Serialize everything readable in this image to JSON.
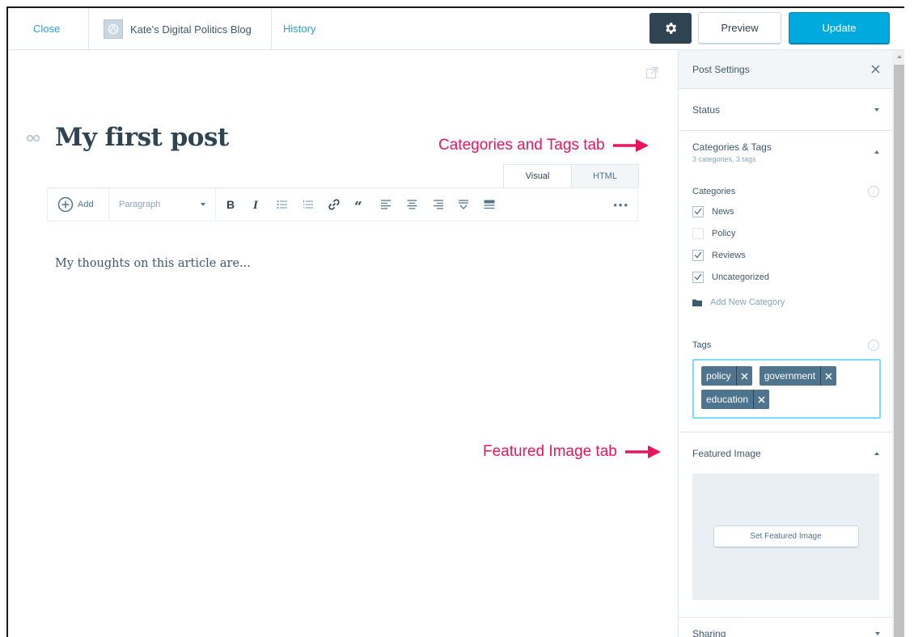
{
  "topbar": {
    "close_label": "Close",
    "site_name": "Kate's Digital Politics Blog",
    "history_label": "History",
    "preview_label": "Preview",
    "update_label": "Update"
  },
  "editor": {
    "title": "My first post",
    "body": "My thoughts on this article are...",
    "tabs": [
      "Visual",
      "HTML"
    ],
    "toolbar": {
      "add_label": "Add",
      "format_label": "Paragraph",
      "more_label": "•••"
    }
  },
  "sidebar": {
    "title": "Post Settings",
    "status_label": "Status",
    "cats_tags_label": "Categories & Tags",
    "cats_tags_summary": "3 categories, 3 tags",
    "categories_label": "Categories",
    "categories": [
      {
        "label": "News",
        "checked": true
      },
      {
        "label": "Policy",
        "checked": false
      },
      {
        "label": "Reviews",
        "checked": true
      },
      {
        "label": "Uncategorized",
        "checked": true
      }
    ],
    "add_category_label": "Add New Category",
    "tags_label": "Tags",
    "tags": [
      "policy",
      "government",
      "education"
    ],
    "featured_image_label": "Featured Image",
    "set_featured_label": "Set Featured Image",
    "sharing_label": "Sharing"
  },
  "annotations": {
    "cats_tags": "Categories and Tags tab",
    "featured": "Featured Image tab"
  },
  "colors": {
    "accent": "#00aadc",
    "link": "#2a9fd6",
    "annotation": "#e9145e",
    "tag_bg": "#4f748e",
    "dark": "#2e4453"
  }
}
